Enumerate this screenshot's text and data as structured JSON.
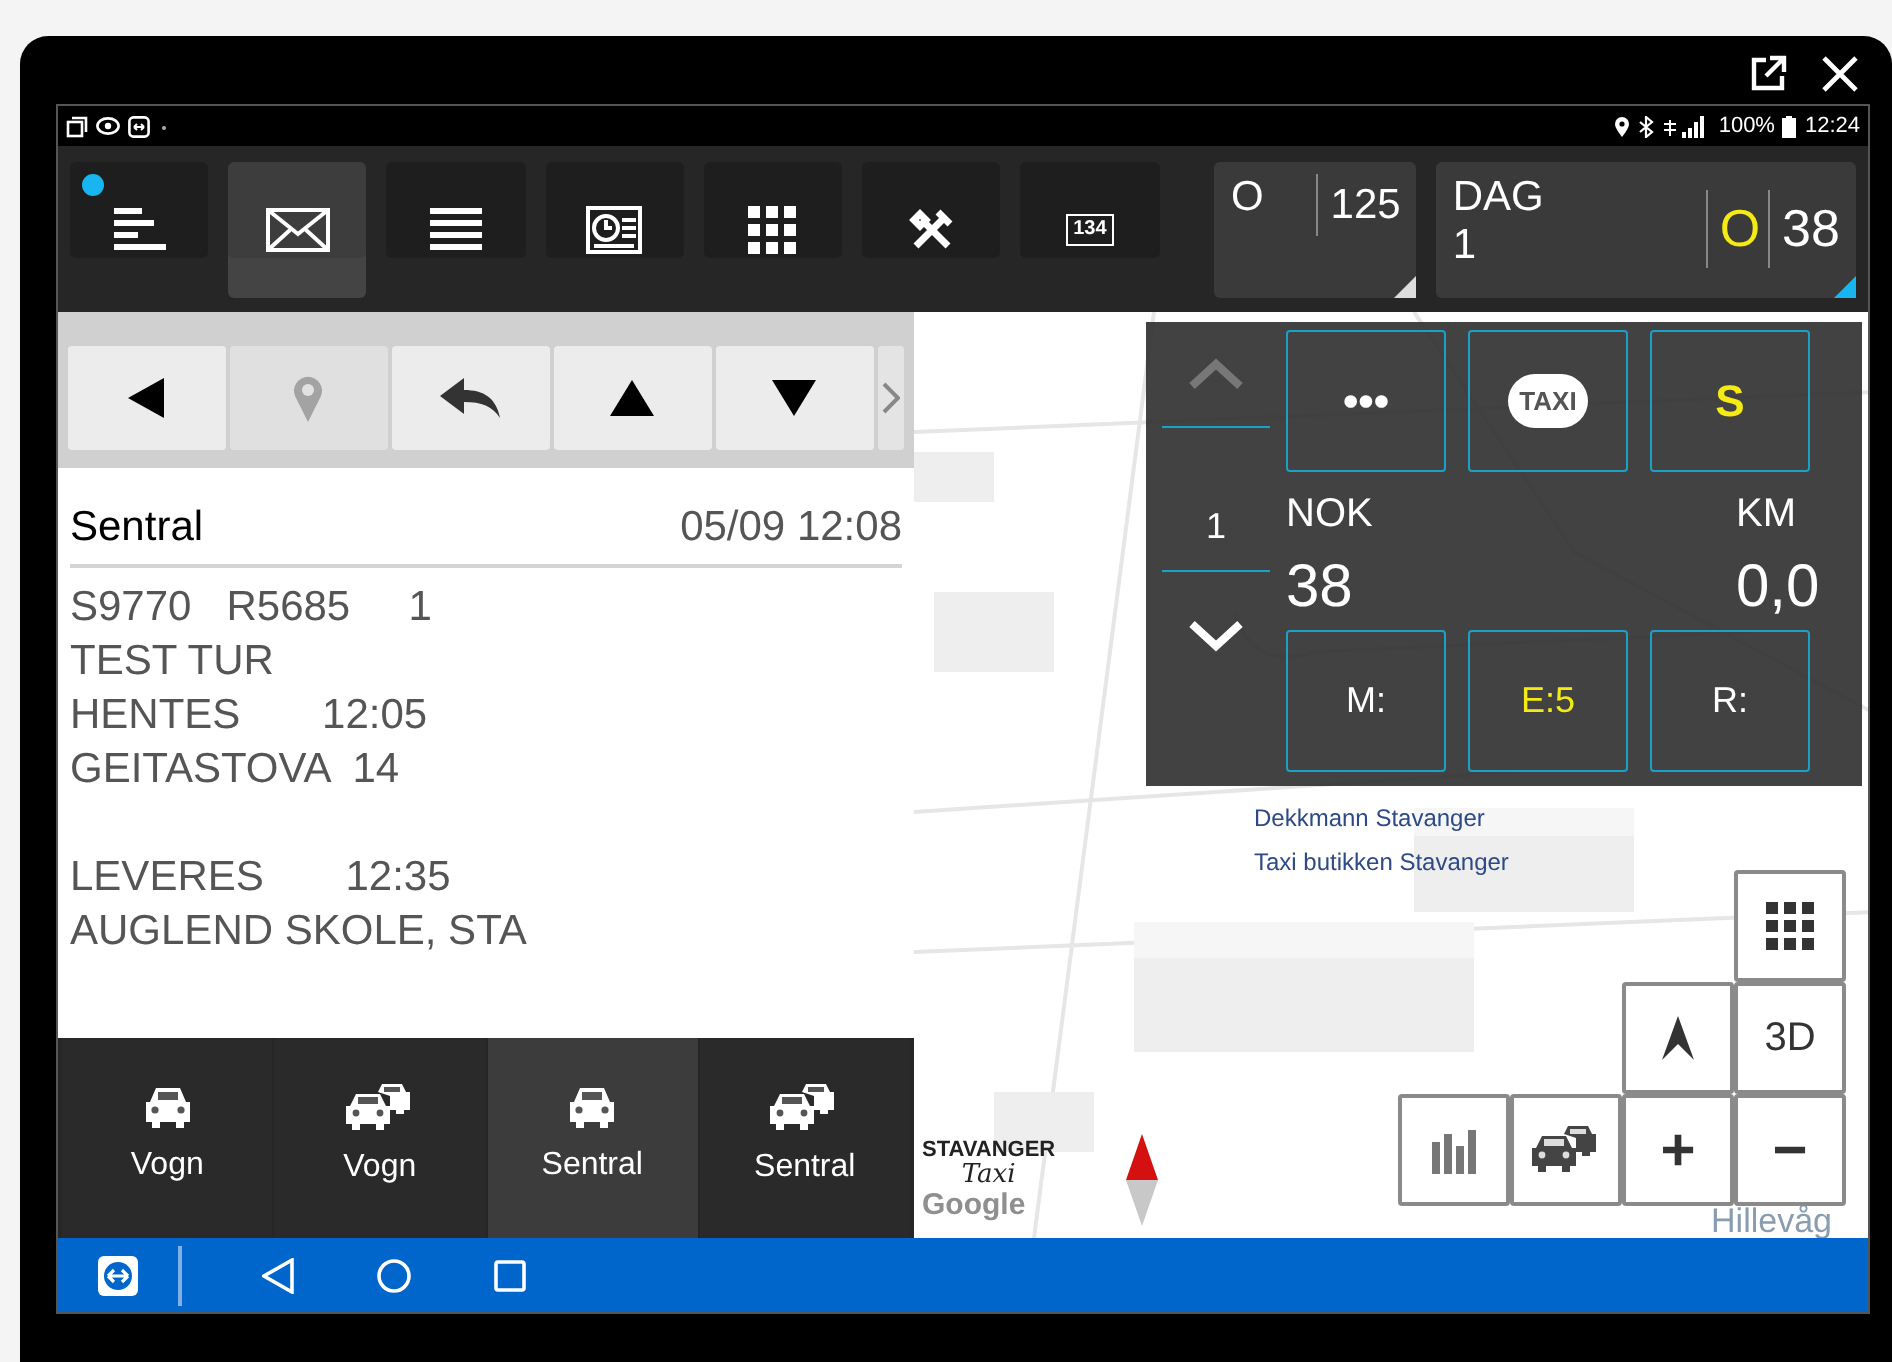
{
  "window_controls": [
    {
      "kind": "popout"
    },
    {
      "kind": "close"
    }
  ],
  "status_bar": {
    "battery": "100%",
    "time": "12:24"
  },
  "toolbar": {
    "buttons": [
      {
        "kind": "menu",
        "selected": false,
        "notification": true
      },
      {
        "kind": "mail",
        "selected": true,
        "notification": false
      },
      {
        "kind": "list",
        "selected": false,
        "notification": false
      },
      {
        "kind": "schedule",
        "selected": false,
        "notification": false
      },
      {
        "kind": "grid",
        "selected": false,
        "notification": false
      },
      {
        "kind": "tools",
        "selected": false,
        "notification": false
      },
      {
        "kind": "meter",
        "selected": false,
        "notification": false,
        "label": "134"
      }
    ],
    "counters": [
      {
        "label": "O",
        "value": "125",
        "accent": false
      },
      {
        "label": "DAG",
        "sub": "1",
        "indicator": "O",
        "value": "38",
        "accent": true
      }
    ]
  },
  "message_nav": [
    {
      "kind": "back",
      "disabled": false
    },
    {
      "kind": "location",
      "disabled": true
    },
    {
      "kind": "reply",
      "disabled": false
    },
    {
      "kind": "up",
      "disabled": false
    },
    {
      "kind": "down",
      "disabled": false
    },
    {
      "kind": "more",
      "disabled": true
    }
  ],
  "message": {
    "sender": "Sentral",
    "datetime": "05/09 12:08",
    "paragraphs": [
      [
        "S9770   R5685     1",
        "TEST TUR",
        "HENTES       12:05",
        "GEITASTOVA  14"
      ],
      [
        "LEVERES       12:35",
        "AUGLEND SKOLE, STA"
      ]
    ]
  },
  "bottom_tabs": [
    {
      "label": "Vogn",
      "kind": "car",
      "selected": false
    },
    {
      "label": "Vogn",
      "kind": "cars",
      "selected": false
    },
    {
      "label": "Sentral",
      "kind": "car",
      "selected": true
    },
    {
      "label": "Sentral",
      "kind": "cars",
      "selected": false
    }
  ],
  "map": {
    "labels": [
      "Dekkmann Stavanger",
      "Taxi butikken Stavanger"
    ],
    "place": "Hillevåg",
    "logo": {
      "line_1": "STAVANGER",
      "line_2": "Taxi"
    },
    "attribution": "Google"
  },
  "meter_panel": {
    "count": "1",
    "top_buttons": [
      {
        "kind": "text",
        "text": "•••",
        "highlight": false
      },
      {
        "kind": "badge",
        "text": "TAXI",
        "highlight": false
      },
      {
        "kind": "text",
        "text": "S",
        "highlight": true
      }
    ],
    "fare_label": "NOK",
    "fare": "38",
    "distance_label": "KM",
    "distance": "0,0",
    "bottom_buttons": [
      {
        "text": "M:",
        "highlight": false
      },
      {
        "text": "E:5",
        "highlight": true
      },
      {
        "text": "R:",
        "highlight": false
      }
    ]
  },
  "map_controls": [
    {
      "kind": "grid"
    },
    {
      "kind": "north"
    },
    {
      "kind": "text",
      "text": "3D"
    },
    {
      "kind": "buildings"
    },
    {
      "kind": "traffic"
    },
    {
      "kind": "text",
      "text": "+"
    },
    {
      "kind": "text",
      "text": "−"
    }
  ],
  "nav_bar": [
    {
      "kind": "remote"
    },
    {
      "kind": "back"
    },
    {
      "kind": "home"
    },
    {
      "kind": "recents"
    }
  ]
}
